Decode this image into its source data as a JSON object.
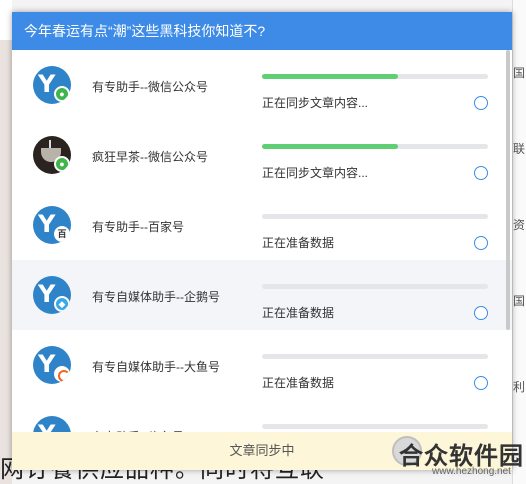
{
  "dialog": {
    "title": "今年春运有点“潮”这些黑科技你知道不?",
    "footer_status": "文章同步中"
  },
  "accounts": [
    {
      "name": "有专助手--微信公众号",
      "status": "正在同步文章内容...",
      "progress": 0.6,
      "badge": "wechat"
    },
    {
      "name": "疯狂早茶--微信公众号",
      "status": "正在同步文章内容...",
      "progress": 0.6,
      "badge": "wechat"
    },
    {
      "name": "有专助手--百家号",
      "status": "正在准备数据",
      "progress": 0,
      "badge": "baijia"
    },
    {
      "name": "有专自媒体助手--企鹅号",
      "status": "正在准备数据",
      "progress": 0,
      "badge": "qie"
    },
    {
      "name": "有专自媒体助手--大鱼号",
      "status": "正在准备数据",
      "progress": 0,
      "badge": "dayu"
    },
    {
      "name": "有专助手--头条号",
      "status": "",
      "progress": 0,
      "badge": "toutiao"
    }
  ],
  "colors": {
    "header": "#3d8be6",
    "progress": "#5fcf73",
    "footer": "#fdf6d8"
  },
  "watermark": {
    "text": "合众软件园",
    "url": "www.hezhong.net"
  },
  "background": {
    "bottom_text": "网订餐供应品种。同时将互联"
  }
}
